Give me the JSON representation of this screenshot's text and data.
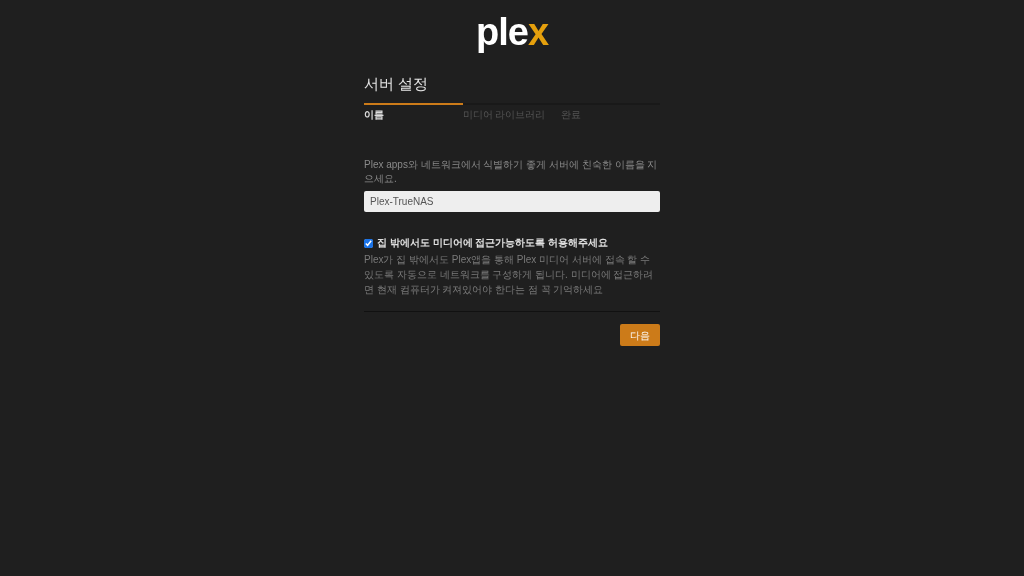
{
  "logo": {
    "text": "ple",
    "accent": "x"
  },
  "title": "서버 설정",
  "steps": [
    {
      "label": "이름",
      "selected": true
    },
    {
      "label": "미디어 라이브러리",
      "selected": false
    },
    {
      "label": "완료",
      "selected": false
    }
  ],
  "description": "Plex apps와 네트워크에서 식별하기 좋게 서버에 친숙한 이름을 지으세요.",
  "name_field": {
    "value": "Plex-TrueNAS"
  },
  "remote_access": {
    "label": "집 밖에서도 미디어에 접근가능하도록 허용해주세요",
    "checked": true,
    "help": "Plex가 집 밖에서도 Plex앱을 통해 Plex 미디어 서버에 접속 할 수 있도록 자동으로 네트워크를 구성하게 됩니다. 미디어에 접근하려면 현재 컴퓨터가 켜져있어야 한다는 점 꼭 기억하세요"
  },
  "next_button": "다음"
}
